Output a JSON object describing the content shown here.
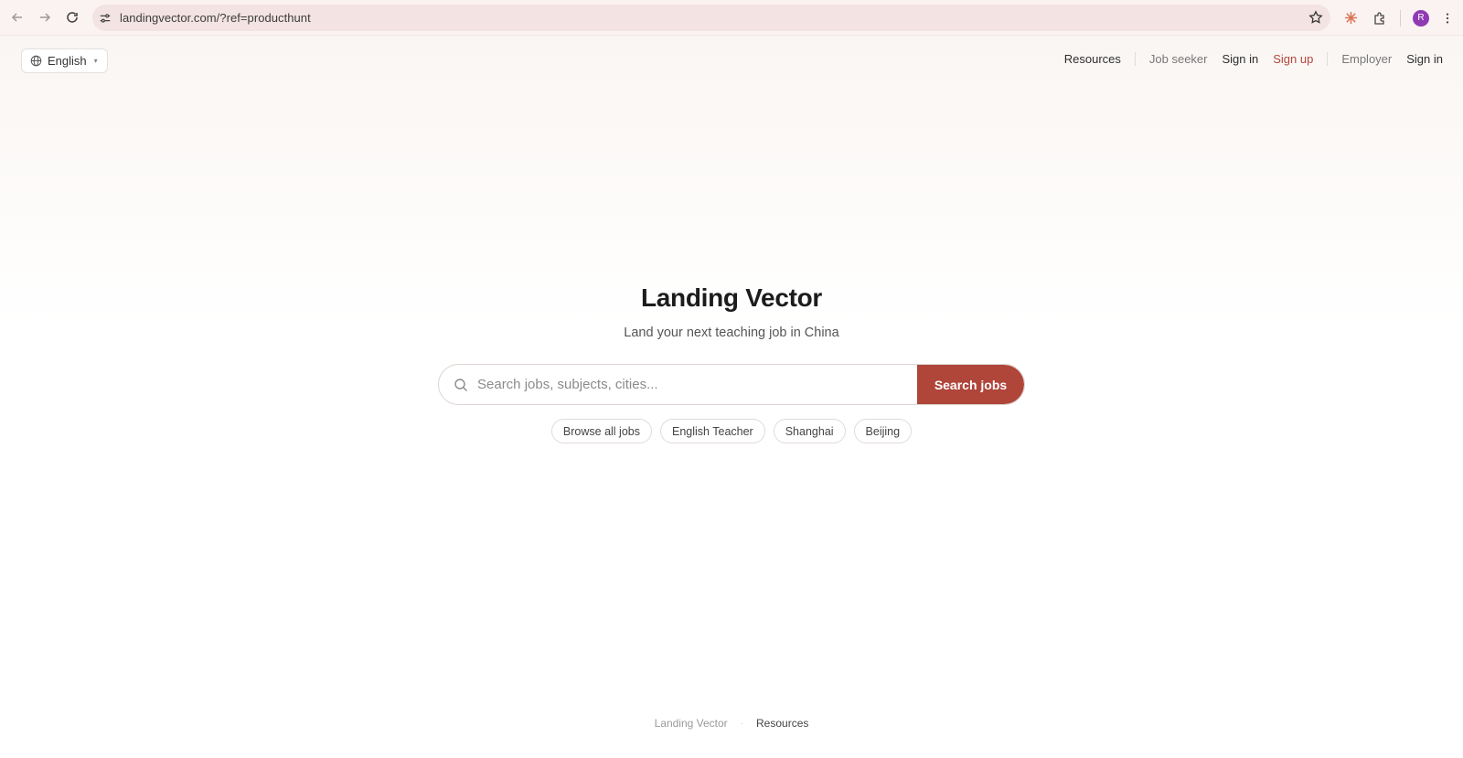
{
  "browser": {
    "url": "landingvector.com/?ref=producthunt",
    "profile_initial": "R"
  },
  "lang": {
    "label": "English"
  },
  "nav": {
    "resources": "Resources",
    "job_seeker": "Job seeker",
    "seeker_sign_in": "Sign in",
    "sign_up": "Sign up",
    "employer": "Employer",
    "employer_sign_in": "Sign in"
  },
  "hero": {
    "title": "Landing Vector",
    "subtitle": "Land your next teaching job in China"
  },
  "search": {
    "placeholder": "Search jobs, subjects, cities...",
    "button": "Search jobs"
  },
  "chips": [
    "Browse all jobs",
    "English Teacher",
    "Shanghai",
    "Beijing"
  ],
  "footer": {
    "brand": "Landing Vector",
    "separator": "·",
    "resources": "Resources"
  },
  "colors": {
    "accent": "#b0453a",
    "profile": "#8e3bb3"
  }
}
